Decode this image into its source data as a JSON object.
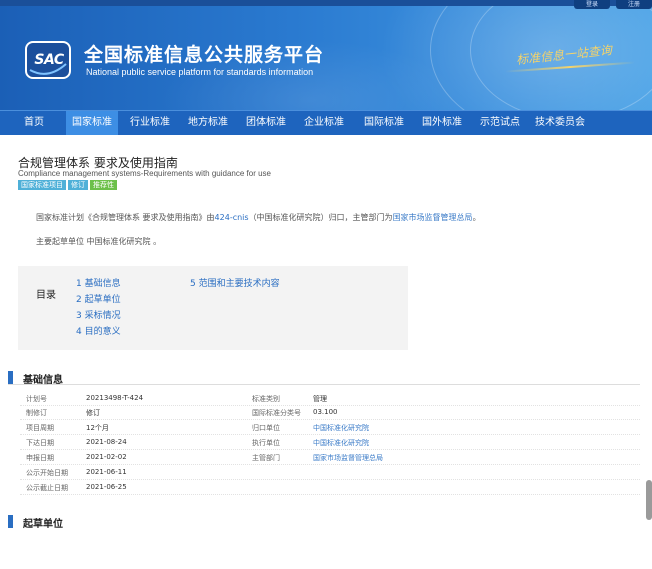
{
  "header": {
    "top_buttons": [
      "登录",
      "注册"
    ],
    "logo_text": "SAC",
    "title_cn": "全国标准信息公共服务平台",
    "title_en": "National public service platform  for standards information",
    "slogan": "标准信息一站查询"
  },
  "nav": {
    "items": [
      {
        "label": "首页"
      },
      {
        "label": "国家标准",
        "active": true
      },
      {
        "label": "行业标准"
      },
      {
        "label": "地方标准"
      },
      {
        "label": "团体标准"
      },
      {
        "label": "企业标准"
      },
      {
        "label": "国际标准"
      },
      {
        "label": "国外标准"
      },
      {
        "label": "示范试点"
      },
      {
        "label": "技术委员会"
      }
    ]
  },
  "standard": {
    "title_cn": "合规管理体系 要求及使用指南",
    "title_en": "Compliance management systems-Requirements with guidance for use",
    "tags": [
      "国家标准项目",
      "修订",
      "推荐性"
    ],
    "desc1_prefix": "国家标准计划《合规管理体系 要求及使用指南》由",
    "desc1_tc": "424-cnis",
    "desc1_mid": "（中国标准化研究院）归口，主管部门为",
    "desc1_dept": "国家市场监督管理总局",
    "desc1_suffix": "。",
    "desc2": "主要起草单位 中国标准化研究院 。"
  },
  "toc": {
    "label": "目录",
    "items": [
      "1  基础信息",
      "2  起草单位",
      "3  采标情况",
      "4  目的意义",
      "5  范围和主要技术内容"
    ]
  },
  "basic_info": {
    "heading": "基础信息",
    "rows": [
      {
        "l1": "计划号",
        "v1": "20213498-T-424",
        "l2": "标准类别",
        "v2": "管理",
        "link2": false
      },
      {
        "l1": "制修订",
        "v1": "修订",
        "l2": "国际标准分类号",
        "v2": "03.100",
        "link2": false
      },
      {
        "l1": "项目周期",
        "v1": "12个月",
        "l2": "归口单位",
        "v2": "中国标准化研究院",
        "link2": true
      },
      {
        "l1": "下达日期",
        "v1": "2021-08-24",
        "l2": "执行单位",
        "v2": "中国标准化研究院",
        "link2": true
      },
      {
        "l1": "申报日期",
        "v1": "2021-02-02",
        "l2": "主管部门",
        "v2": "国家市场监督管理总局",
        "link2": true
      },
      {
        "l1": "公示开始日期",
        "v1": "2021-06-11",
        "l2": "",
        "v2": "",
        "link2": false
      },
      {
        "l1": "公示截止日期",
        "v1": "2021-06-25",
        "l2": "",
        "v2": "",
        "link2": false
      }
    ]
  },
  "drafting": {
    "heading": "起草单位"
  },
  "colors": {
    "nav_bg": "#1e64be",
    "nav_active": "#3d8ee4",
    "link": "#2a6ec2",
    "accent_bar": "#2a6ec2"
  }
}
